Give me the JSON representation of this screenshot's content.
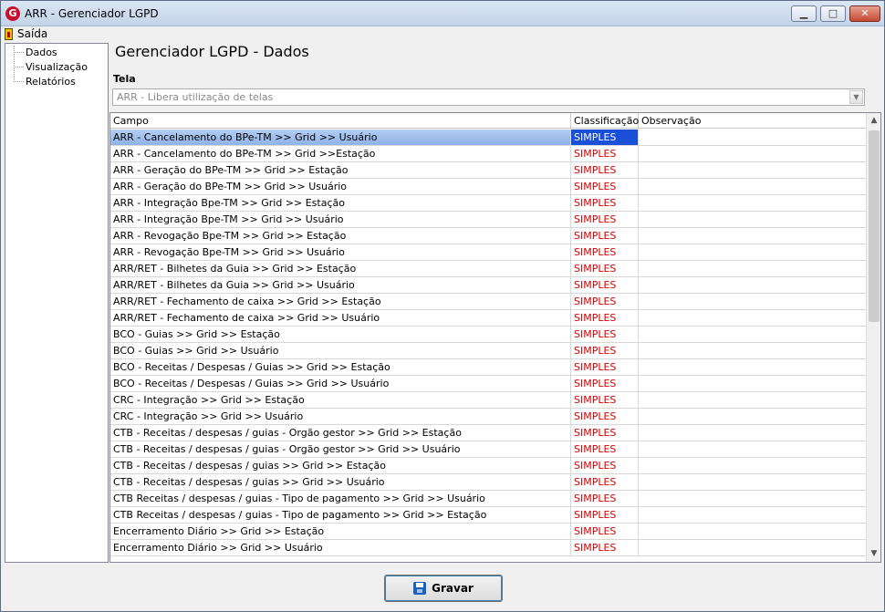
{
  "window": {
    "title": "ARR - Gerenciador LGPD",
    "min_glyph": "▁",
    "max_glyph": "□",
    "close_glyph": "✕"
  },
  "menu": {
    "exit_label": "Saída"
  },
  "tree": {
    "items": [
      "Dados",
      "Visualização",
      "Relatórios"
    ]
  },
  "page": {
    "title": "Gerenciador LGPD - Dados"
  },
  "tela": {
    "label": "Tela",
    "value": "ARR - Libera utilização de telas"
  },
  "grid": {
    "columns": [
      "Campo",
      "Classificação",
      "Observação"
    ],
    "selected_index": 0,
    "rows": [
      {
        "campo": "ARR - Cancelamento do BPe-TM >> Grid >> Usuário",
        "classificacao": "SIMPLES",
        "observacao": ""
      },
      {
        "campo": "ARR - Cancelamento do BPe-TM >> Grid >>Estação",
        "classificacao": "SIMPLES",
        "observacao": ""
      },
      {
        "campo": "ARR - Geração do BPe-TM >> Grid >> Estação",
        "classificacao": "SIMPLES",
        "observacao": ""
      },
      {
        "campo": "ARR - Geração do BPe-TM >> Grid >> Usuário",
        "classificacao": "SIMPLES",
        "observacao": ""
      },
      {
        "campo": "ARR - Integração Bpe-TM >> Grid >> Estação",
        "classificacao": "SIMPLES",
        "observacao": ""
      },
      {
        "campo": "ARR - Integração Bpe-TM >> Grid >> Usuário",
        "classificacao": "SIMPLES",
        "observacao": ""
      },
      {
        "campo": "ARR - Revogação Bpe-TM >> Grid >> Estação",
        "classificacao": "SIMPLES",
        "observacao": ""
      },
      {
        "campo": "ARR - Revogação Bpe-TM >> Grid >> Usuário",
        "classificacao": "SIMPLES",
        "observacao": ""
      },
      {
        "campo": "ARR/RET - Bilhetes da Guia >> Grid >> Estação",
        "classificacao": "SIMPLES",
        "observacao": ""
      },
      {
        "campo": "ARR/RET - Bilhetes da Guia >> Grid >> Usuário",
        "classificacao": "SIMPLES",
        "observacao": ""
      },
      {
        "campo": "ARR/RET - Fechamento de caixa >> Grid >> Estação",
        "classificacao": "SIMPLES",
        "observacao": ""
      },
      {
        "campo": "ARR/RET - Fechamento de caixa >> Grid >> Usuário",
        "classificacao": "SIMPLES",
        "observacao": ""
      },
      {
        "campo": "BCO - Guias >> Grid >> Estação",
        "classificacao": "SIMPLES",
        "observacao": ""
      },
      {
        "campo": "BCO - Guias >> Grid >> Usuário",
        "classificacao": "SIMPLES",
        "observacao": ""
      },
      {
        "campo": "BCO - Receitas / Despesas / Guias >> Grid >> Estação",
        "classificacao": "SIMPLES",
        "observacao": ""
      },
      {
        "campo": "BCO - Receitas / Despesas / Guias >> Grid >> Usuário",
        "classificacao": "SIMPLES",
        "observacao": ""
      },
      {
        "campo": "CRC - Integração >> Grid >> Estação",
        "classificacao": "SIMPLES",
        "observacao": ""
      },
      {
        "campo": "CRC - Integração >> Grid >> Usuário",
        "classificacao": "SIMPLES",
        "observacao": ""
      },
      {
        "campo": "CTB - Receitas / despesas / guias - Orgão gestor >> Grid >> Estação",
        "classificacao": "SIMPLES",
        "observacao": ""
      },
      {
        "campo": "CTB - Receitas / despesas / guias - Orgão gestor >> Grid >> Usuário",
        "classificacao": "SIMPLES",
        "observacao": ""
      },
      {
        "campo": "CTB - Receitas / despesas / guias >> Grid >> Estação",
        "classificacao": "SIMPLES",
        "observacao": ""
      },
      {
        "campo": "CTB - Receitas / despesas / guias >> Grid >> Usuário",
        "classificacao": "SIMPLES",
        "observacao": ""
      },
      {
        "campo": "CTB Receitas / despesas / guias - Tipo de pagamento >> Grid >>  Usuário",
        "classificacao": "SIMPLES",
        "observacao": ""
      },
      {
        "campo": "CTB Receitas / despesas / guias - Tipo de pagamento >> Grid >> Estação",
        "classificacao": "SIMPLES",
        "observacao": ""
      },
      {
        "campo": "Encerramento Diário >> Grid >> Estação",
        "classificacao": "SIMPLES",
        "observacao": ""
      },
      {
        "campo": "Encerramento Diário >> Grid >> Usuário",
        "classificacao": "SIMPLES",
        "observacao": ""
      }
    ]
  },
  "footer": {
    "save_label": "Gravar"
  },
  "colors": {
    "classification_text": "#d40000",
    "selection": "#1a4fd8"
  }
}
